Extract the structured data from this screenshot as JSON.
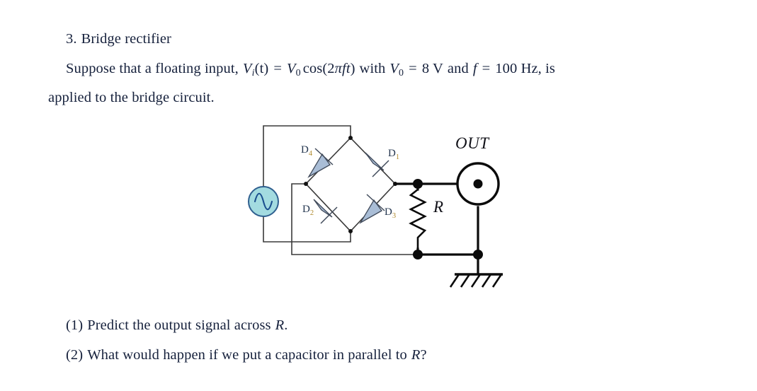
{
  "document": {
    "heading": {
      "number": "3.",
      "title": "Bridge rectifier"
    },
    "problem": {
      "line1_a": "Suppose that a floating input,",
      "var_vi": "V",
      "var_vi_sub": "i",
      "vi_arg": "(t)",
      "eq1": "=",
      "var_v0": "V",
      "var_v0_sub": "0",
      "cos_expr": "cos(2",
      "pi": "π",
      "f_var": "f",
      "t_var": "t",
      "close_paren": ")",
      "with_word": "with",
      "var_v0b": "V",
      "var_v0b_sub": "0",
      "eq2": "=",
      "amplitude": "8 V",
      "and_word": "and",
      "f_var2": "f",
      "eq3": "=",
      "frequency": "100 Hz, is",
      "line2": "applied to the bridge circuit."
    },
    "questions": [
      {
        "marker": "(1)",
        "text_before": "Predict the output signal across",
        "symbol": "R",
        "text_after": "."
      },
      {
        "marker": "(2)",
        "text_before": "What would happen if we put a capacitor in parallel to",
        "symbol": "R",
        "text_after": "?"
      }
    ]
  },
  "circuit": {
    "title": "bridge-rectifier-schematic",
    "source": {
      "name": "ac-voltage-source",
      "fill": "#a3dbe0",
      "stroke": "#2f5f8f",
      "wave_color": "#1b4f8f"
    },
    "diodes": [
      {
        "id": "D1",
        "letter": "D",
        "subscript": "1"
      },
      {
        "id": "D2",
        "letter": "D",
        "subscript": "2"
      },
      {
        "id": "D3",
        "letter": "D",
        "subscript": "3"
      },
      {
        "id": "D4",
        "letter": "D",
        "subscript": "4"
      }
    ],
    "diode_style": {
      "fill": "#a9bdd6",
      "stroke": "#404a5a"
    },
    "resistor": {
      "label": "R"
    },
    "output_terminal": {
      "label": "OUT"
    },
    "ground": {
      "name": "earth-ground"
    },
    "wire_color": "#3a3a3a",
    "bold_wire_color": "#0b0b0b"
  }
}
